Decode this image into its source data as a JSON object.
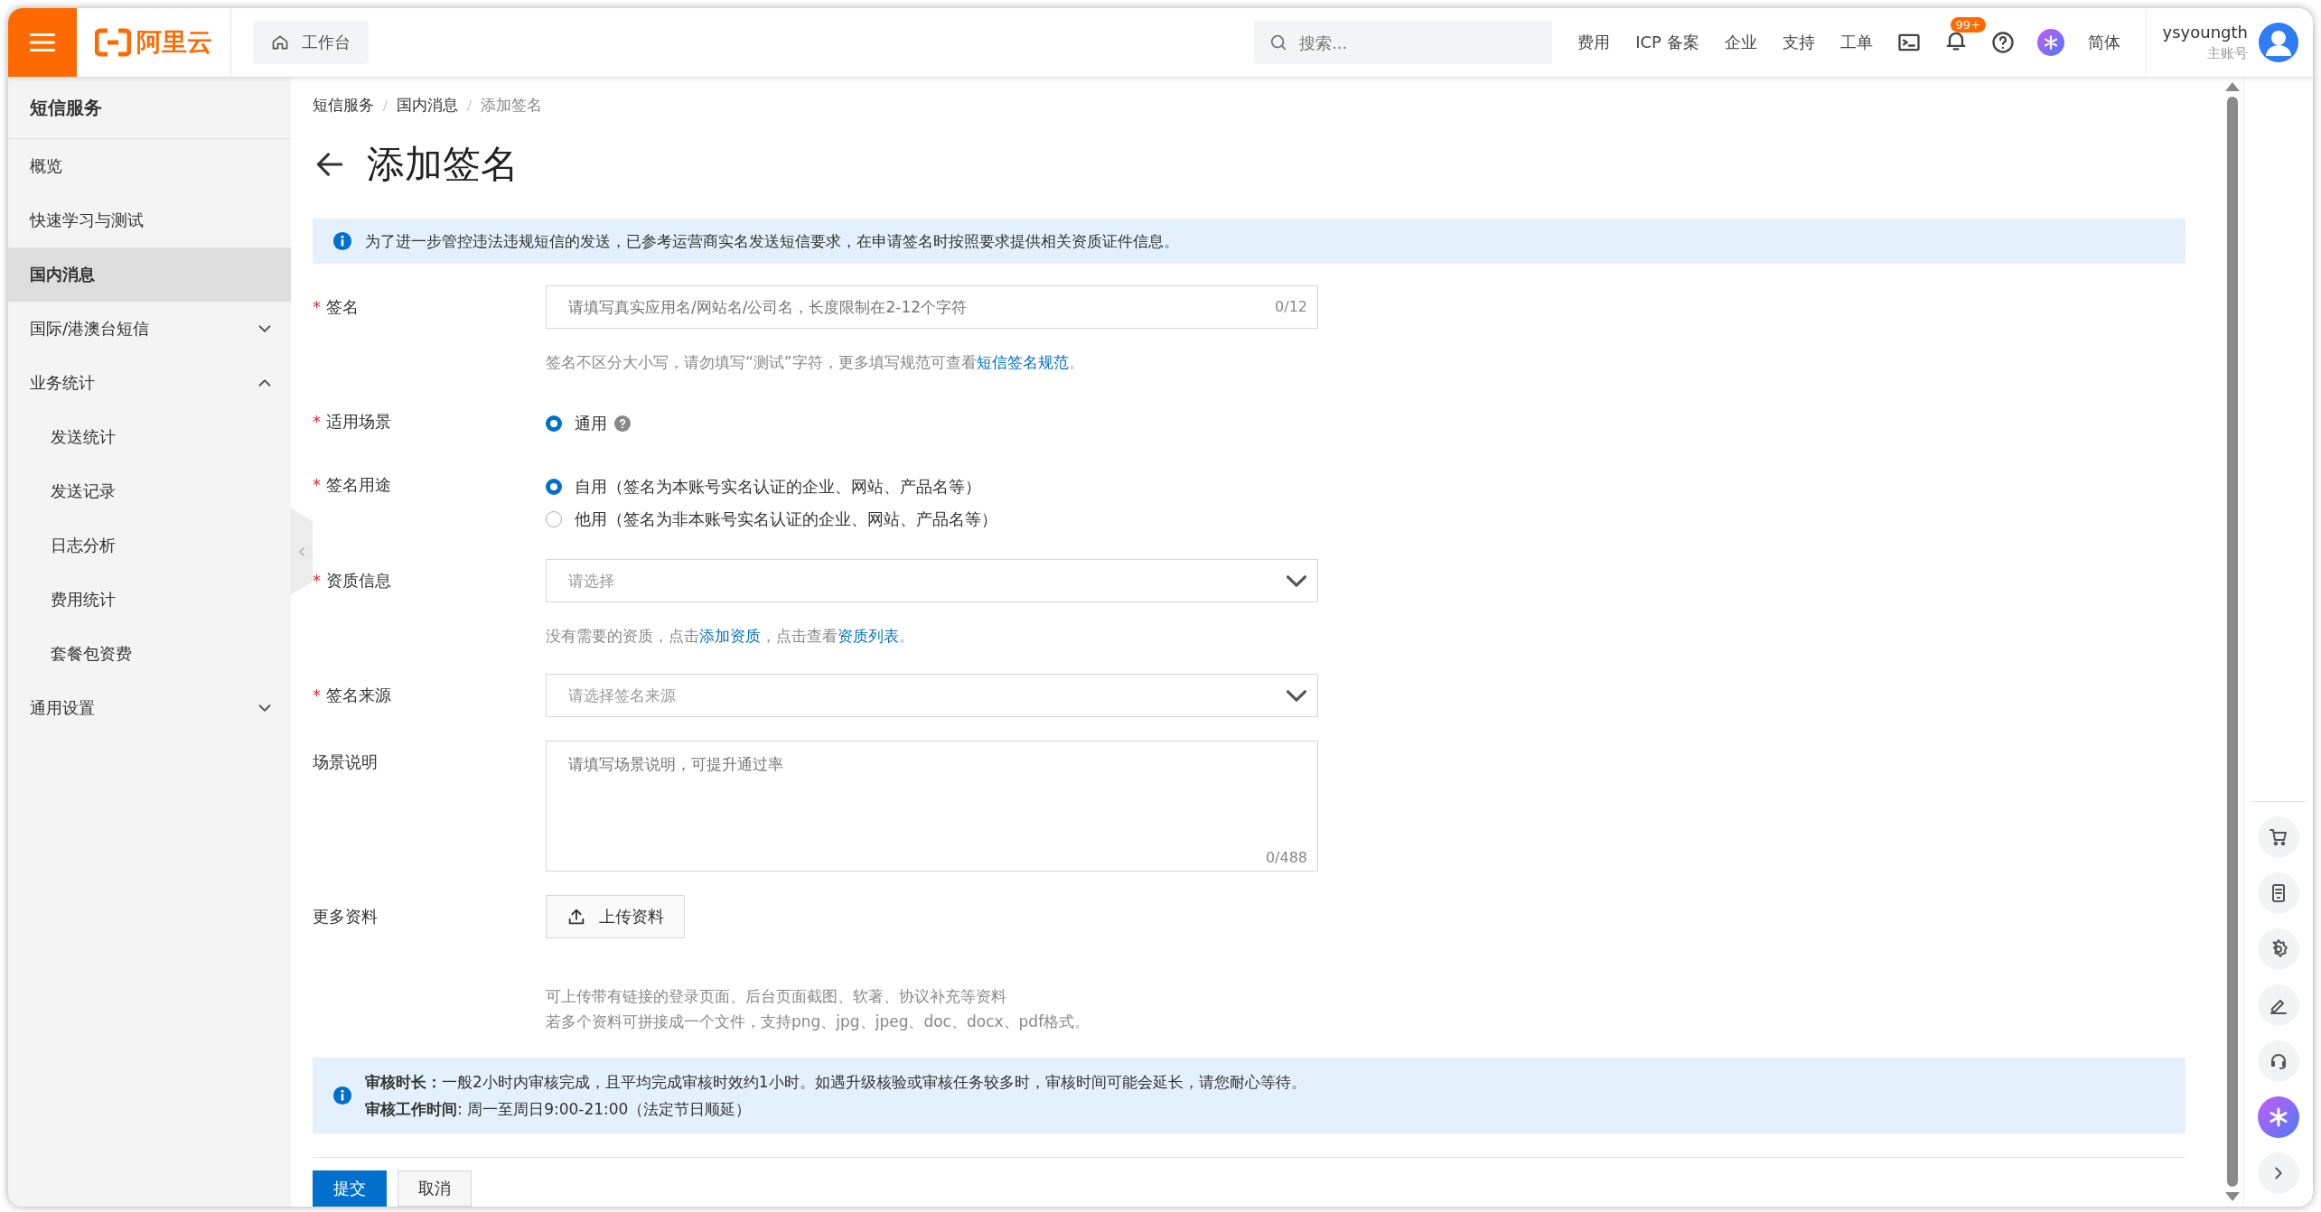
{
  "topbar": {
    "brand": "阿里云",
    "workbench": "工作台",
    "search": {
      "placeholder": "搜索..."
    },
    "links": [
      "费用",
      "ICP 备案",
      "企业",
      "支持",
      "工单"
    ],
    "notification_badge": "99+",
    "language": "简体",
    "user": {
      "name": "ysyoungth",
      "role": "主账号"
    }
  },
  "sidebar": {
    "title": "短信服务",
    "items": [
      {
        "label": "概览",
        "selected": false
      },
      {
        "label": "快速学习与测试",
        "selected": false
      },
      {
        "label": "国内消息",
        "selected": true
      },
      {
        "label": "国际/港澳台短信",
        "selected": false,
        "expanded": false
      },
      {
        "label": "业务统计",
        "selected": false,
        "expanded": true,
        "children": [
          {
            "label": "发送统计",
            "selected": false
          },
          {
            "label": "发送记录",
            "selected": false
          },
          {
            "label": "日志分析",
            "selected": false
          },
          {
            "label": "费用统计",
            "selected": false
          },
          {
            "label": "套餐包资费",
            "selected": false
          }
        ]
      },
      {
        "label": "通用设置",
        "selected": false,
        "expanded": false
      }
    ]
  },
  "breadcrumb": [
    "短信服务",
    "国内消息",
    "添加签名"
  ],
  "page_title": "添加签名",
  "notice": "为了进一步管控违法违规短信的发送，已参考运营商实名发送短信要求，在申请签名时按照要求提供相关资质证件信息。",
  "form": [
    {
      "kind": "input",
      "required_mark": "*",
      "label": "签名",
      "placeholder": "请填写真实应用名/网站名/公司名，长度限制在2-12个字符",
      "counter": "0/12",
      "help": [
        {
          "kind": "text",
          "text": "签名不区分大小写，请勿填写“测试”字符，更多填写规范可查看"
        },
        {
          "kind": "link",
          "text": "短信签名规范"
        },
        {
          "kind": "text",
          "text": "。"
        }
      ]
    },
    {
      "kind": "radio",
      "required_mark": "*",
      "label": "适用场景",
      "options": [
        {
          "label": "通用",
          "selected": true,
          "help_icon": true
        }
      ]
    },
    {
      "kind": "radio",
      "required_mark": "*",
      "label": "签名用途",
      "options": [
        {
          "label": "自用（签名为本账号实名认证的企业、网站、产品名等）",
          "selected": true
        },
        {
          "label": "他用（签名为非本账号实名认证的企业、网站、产品名等）",
          "selected": false
        }
      ]
    },
    {
      "kind": "select",
      "required_mark": "*",
      "label": "资质信息",
      "placeholder": "请选择",
      "help": [
        {
          "kind": "text",
          "text": "没有需要的资质，点击"
        },
        {
          "kind": "link",
          "text": "添加资质"
        },
        {
          "kind": "text",
          "text": "，点击查看"
        },
        {
          "kind": "link",
          "text": "资质列表"
        },
        {
          "kind": "text",
          "text": "。"
        }
      ]
    },
    {
      "kind": "select",
      "required_mark": "*",
      "label": "签名来源",
      "placeholder": "请选择签名来源"
    },
    {
      "kind": "textarea",
      "label": "场景说明",
      "placeholder": "请填写场景说明，可提升通过率",
      "counter": "0/488"
    },
    {
      "kind": "upload",
      "label": "更多资料",
      "button": "上传资料",
      "notes": [
        "可上传带有链接的登录页面、后台页面截图、软著、协议补充等资料",
        "若多个资料可拼接成一个文件，支持png、jpg、jpeg、doc、docx、pdf格式。"
      ]
    }
  ],
  "review_notice": [
    "**审核时长：**一般2小时内审核完成，且平均完成审核时效约1小时。如遇升级核验或审核任务较多时，审核时间可能会延长，请您耐心等待。",
    "**审核工作时间**: 周一至周日9:00-21:00（法定节日顺延）"
  ],
  "actions": [
    {
      "label": "提交",
      "kind": "primary"
    },
    {
      "label": "取消",
      "kind": "default"
    }
  ]
}
